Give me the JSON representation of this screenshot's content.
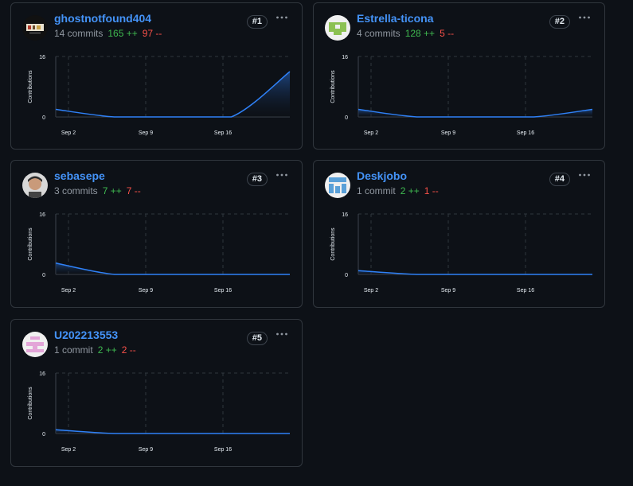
{
  "contributors": [
    {
      "name": "ghostnotfound404",
      "commits": "14 commits",
      "additions": "165 ++",
      "deletions": "97 --",
      "rank": "#1",
      "avatar": "photo-icon"
    },
    {
      "name": "Estrella-ticona",
      "commits": "4 commits",
      "additions": "128 ++",
      "deletions": "5 --",
      "rank": "#2",
      "avatar": "identicon-green"
    },
    {
      "name": "sebasepe",
      "commits": "3 commits",
      "additions": "7 ++",
      "deletions": "7 --",
      "rank": "#3",
      "avatar": "photo-icon"
    },
    {
      "name": "Deskjobo",
      "commits": "1 commit",
      "additions": "2 ++",
      "deletions": "1 --",
      "rank": "#4",
      "avatar": "identicon-blue"
    },
    {
      "name": "U202213553",
      "commits": "1 commit",
      "additions": "2 ++",
      "deletions": "2 --",
      "rank": "#5",
      "avatar": "identicon-pink"
    }
  ],
  "colors": {
    "accent": "#4493f8",
    "additions": "#3fb950",
    "deletions": "#f85149",
    "line": "#2f81f7",
    "background": "#0d1117",
    "border": "#30363d"
  },
  "chart_data": [
    {
      "type": "area",
      "ylabel": "Contributions",
      "ylim": [
        0,
        16
      ],
      "tick_labels": [
        "Sep 2",
        "Sep 9",
        "Sep 16"
      ],
      "y_tick_labels": [
        "16",
        "0"
      ],
      "series": [
        {
          "values": [
            2,
            0,
            0,
            0,
            12
          ]
        }
      ]
    },
    {
      "type": "area",
      "ylabel": "Contributions",
      "ylim": [
        0,
        16
      ],
      "tick_labels": [
        "Sep 2",
        "Sep 9",
        "Sep 16"
      ],
      "y_tick_labels": [
        "16",
        "0"
      ],
      "series": [
        {
          "values": [
            2,
            0,
            0,
            0,
            2
          ]
        }
      ]
    },
    {
      "type": "area",
      "ylabel": "Contributions",
      "ylim": [
        0,
        16
      ],
      "tick_labels": [
        "Sep 2",
        "Sep 9",
        "Sep 16"
      ],
      "y_tick_labels": [
        "16",
        "0"
      ],
      "series": [
        {
          "values": [
            3,
            0,
            0,
            0,
            0
          ]
        }
      ]
    },
    {
      "type": "area",
      "ylabel": "Contributions",
      "ylim": [
        0,
        16
      ],
      "tick_labels": [
        "Sep 2",
        "Sep 9",
        "Sep 16"
      ],
      "y_tick_labels": [
        "16",
        "0"
      ],
      "series": [
        {
          "values": [
            1,
            0,
            0,
            0,
            0
          ]
        }
      ]
    },
    {
      "type": "area",
      "ylabel": "Contributions",
      "ylim": [
        0,
        16
      ],
      "tick_labels": [
        "Sep 2",
        "Sep 9",
        "Sep 16"
      ],
      "y_tick_labels": [
        "16",
        "0"
      ],
      "series": [
        {
          "values": [
            1,
            0,
            0,
            0,
            0
          ]
        }
      ]
    }
  ]
}
